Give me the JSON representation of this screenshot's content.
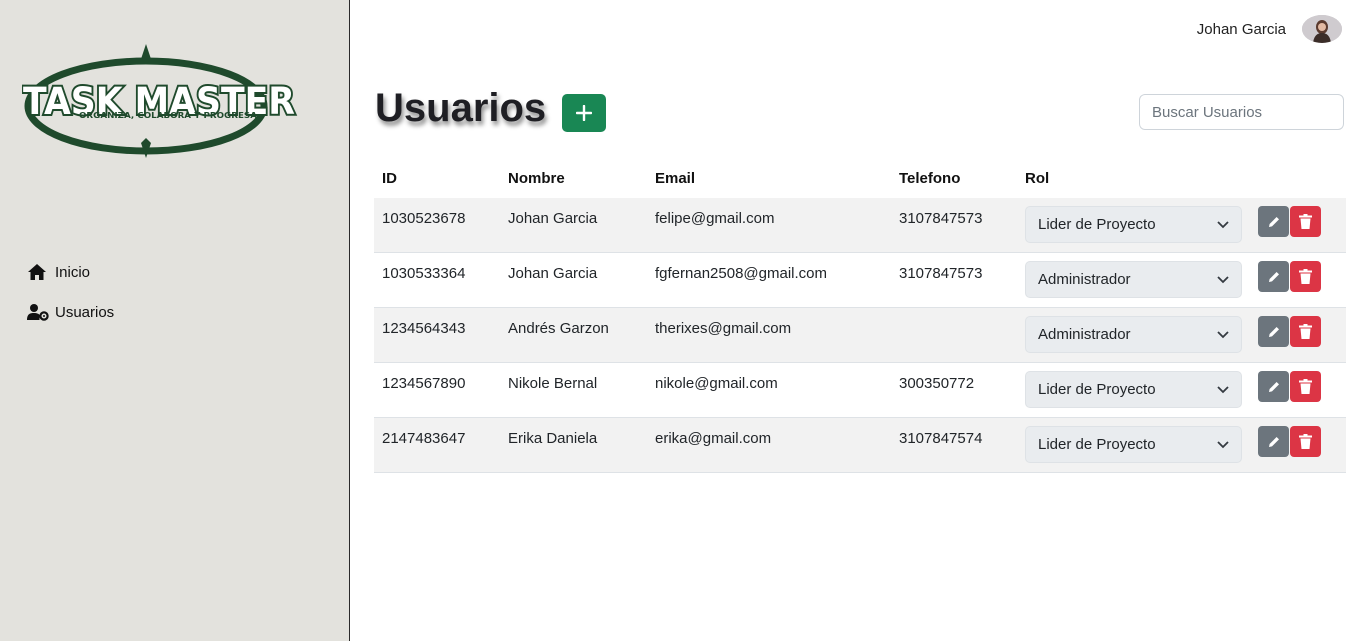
{
  "sidebar": {
    "logo": {
      "line1": "TASK MASTER",
      "line2": "ORGANIZA, COLABORA Y PROGRESA"
    },
    "items": [
      {
        "label": "Inicio",
        "icon": "home-icon"
      },
      {
        "label": "Usuarios",
        "icon": "user-gear-icon"
      }
    ]
  },
  "header": {
    "user_name": "Johan Garcia"
  },
  "main": {
    "title": "Usuarios",
    "add_label": "+",
    "search_placeholder": "Buscar Usuarios"
  },
  "table": {
    "columns": [
      "ID",
      "Nombre",
      "Email",
      "Telefono",
      "Rol"
    ],
    "rows": [
      {
        "id": "1030523678",
        "name": "Johan Garcia",
        "email": "felipe@gmail.com",
        "phone": "3107847573",
        "role": "Lider de Proyecto"
      },
      {
        "id": "1030533364",
        "name": "Johan Garcia",
        "email": "fgfernan2508@gmail.com",
        "phone": "3107847573",
        "role": "Administrador"
      },
      {
        "id": "1234564343",
        "name": "Andrés Garzon",
        "email": "therixes@gmail.com",
        "phone": "",
        "role": "Administrador"
      },
      {
        "id": "1234567890",
        "name": "Nikole Bernal",
        "email": "nikole@gmail.com",
        "phone": "300350772",
        "role": "Lider de Proyecto"
      },
      {
        "id": "2147483647",
        "name": "Erika Daniela",
        "email": "erika@gmail.com",
        "phone": "3107847574",
        "role": "Lider de Proyecto"
      }
    ]
  },
  "colors": {
    "sidebar_bg": "#e3e2dd",
    "logo_green": "#1f4a2c",
    "add_button": "#198754",
    "edit_button": "#6c757d",
    "delete_button": "#dc3545"
  }
}
